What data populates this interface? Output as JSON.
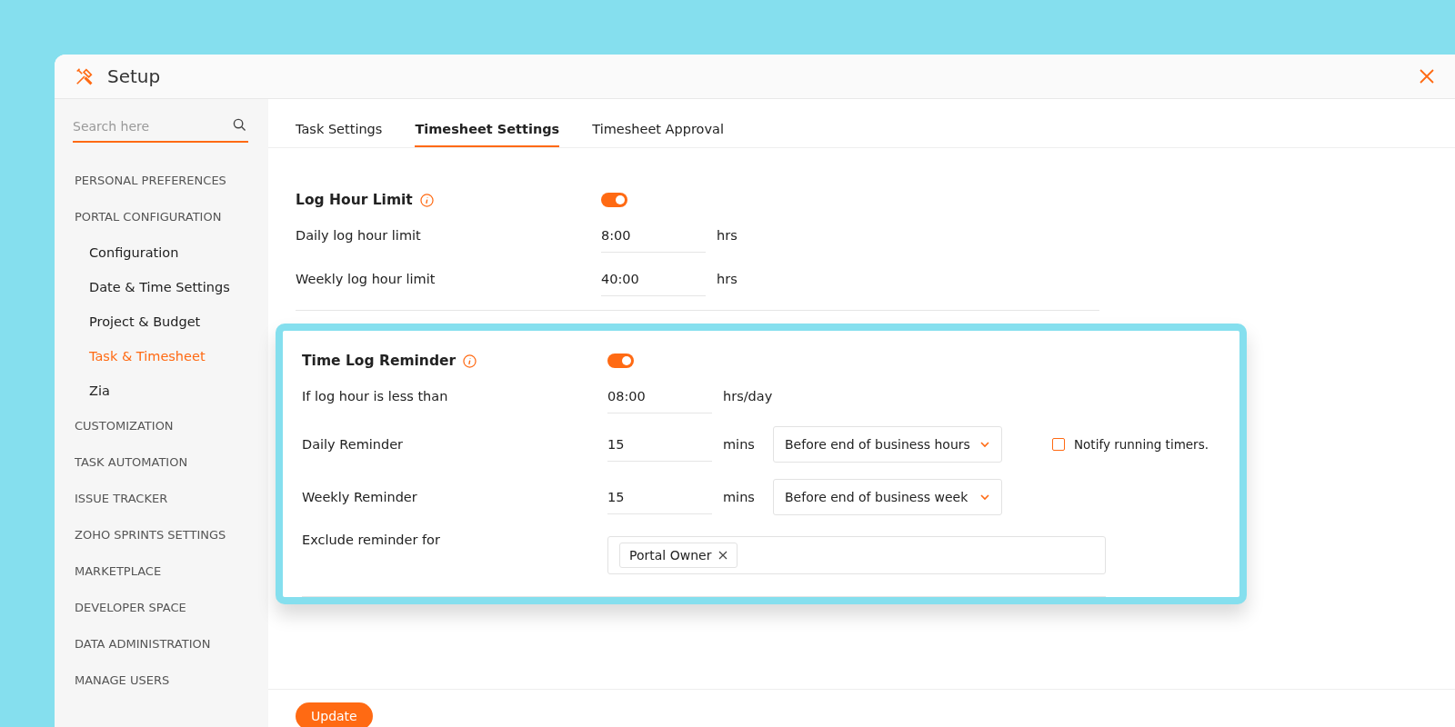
{
  "window": {
    "title": "Setup"
  },
  "sidebar": {
    "search": {
      "placeholder": "Search here"
    },
    "items": [
      {
        "label": "PERSONAL PREFERENCES",
        "selected": false
      },
      {
        "label": "PORTAL CONFIGURATION",
        "selected": false,
        "children": [
          {
            "label": "Configuration",
            "selected": false
          },
          {
            "label": "Date & Time Settings",
            "selected": false
          },
          {
            "label": "Project & Budget",
            "selected": false
          },
          {
            "label": "Task & Timesheet",
            "selected": true
          },
          {
            "label": "Zia",
            "selected": false
          }
        ]
      },
      {
        "label": "CUSTOMIZATION",
        "selected": false
      },
      {
        "label": "TASK AUTOMATION",
        "selected": false
      },
      {
        "label": "ISSUE TRACKER",
        "selected": false
      },
      {
        "label": "ZOHO SPRINTS SETTINGS",
        "selected": false
      },
      {
        "label": "MARKETPLACE",
        "selected": false
      },
      {
        "label": "DEVELOPER SPACE",
        "selected": false
      },
      {
        "label": "DATA ADMINISTRATION",
        "selected": false
      },
      {
        "label": "MANAGE USERS",
        "selected": false
      }
    ]
  },
  "tabs": [
    {
      "label": "Task Settings",
      "selected": false
    },
    {
      "label": "Timesheet Settings",
      "selected": true
    },
    {
      "label": "Timesheet Approval",
      "selected": false
    }
  ],
  "sections": [
    {
      "title": "Log Hour Limit",
      "on": true,
      "highlighted": false,
      "rows": [
        {
          "kind": "field",
          "label": "Daily log hour limit",
          "value": "8:00",
          "unit": "hrs"
        },
        {
          "kind": "field",
          "label": "Weekly log hour limit",
          "value": "40:00",
          "unit": "hrs"
        }
      ]
    },
    {
      "title": "Time Log Reminder",
      "on": true,
      "highlighted": true,
      "rows": [
        {
          "kind": "field",
          "label": "If log hour is less than",
          "value": "08:00",
          "unit": "hrs/day"
        },
        {
          "kind": "select",
          "label": "Daily Reminder",
          "value": "15",
          "unit": "mins",
          "option": "Before end of business hours",
          "checkbox": {
            "label": "Notify running timers.",
            "checked": false
          }
        },
        {
          "kind": "select",
          "label": "Weekly Reminder",
          "value": "15",
          "unit": "mins",
          "option": "Before end of business week"
        },
        {
          "kind": "tags",
          "label": "Exclude reminder for",
          "tags": [
            "Portal Owner"
          ]
        }
      ]
    }
  ],
  "update_button": "Update"
}
